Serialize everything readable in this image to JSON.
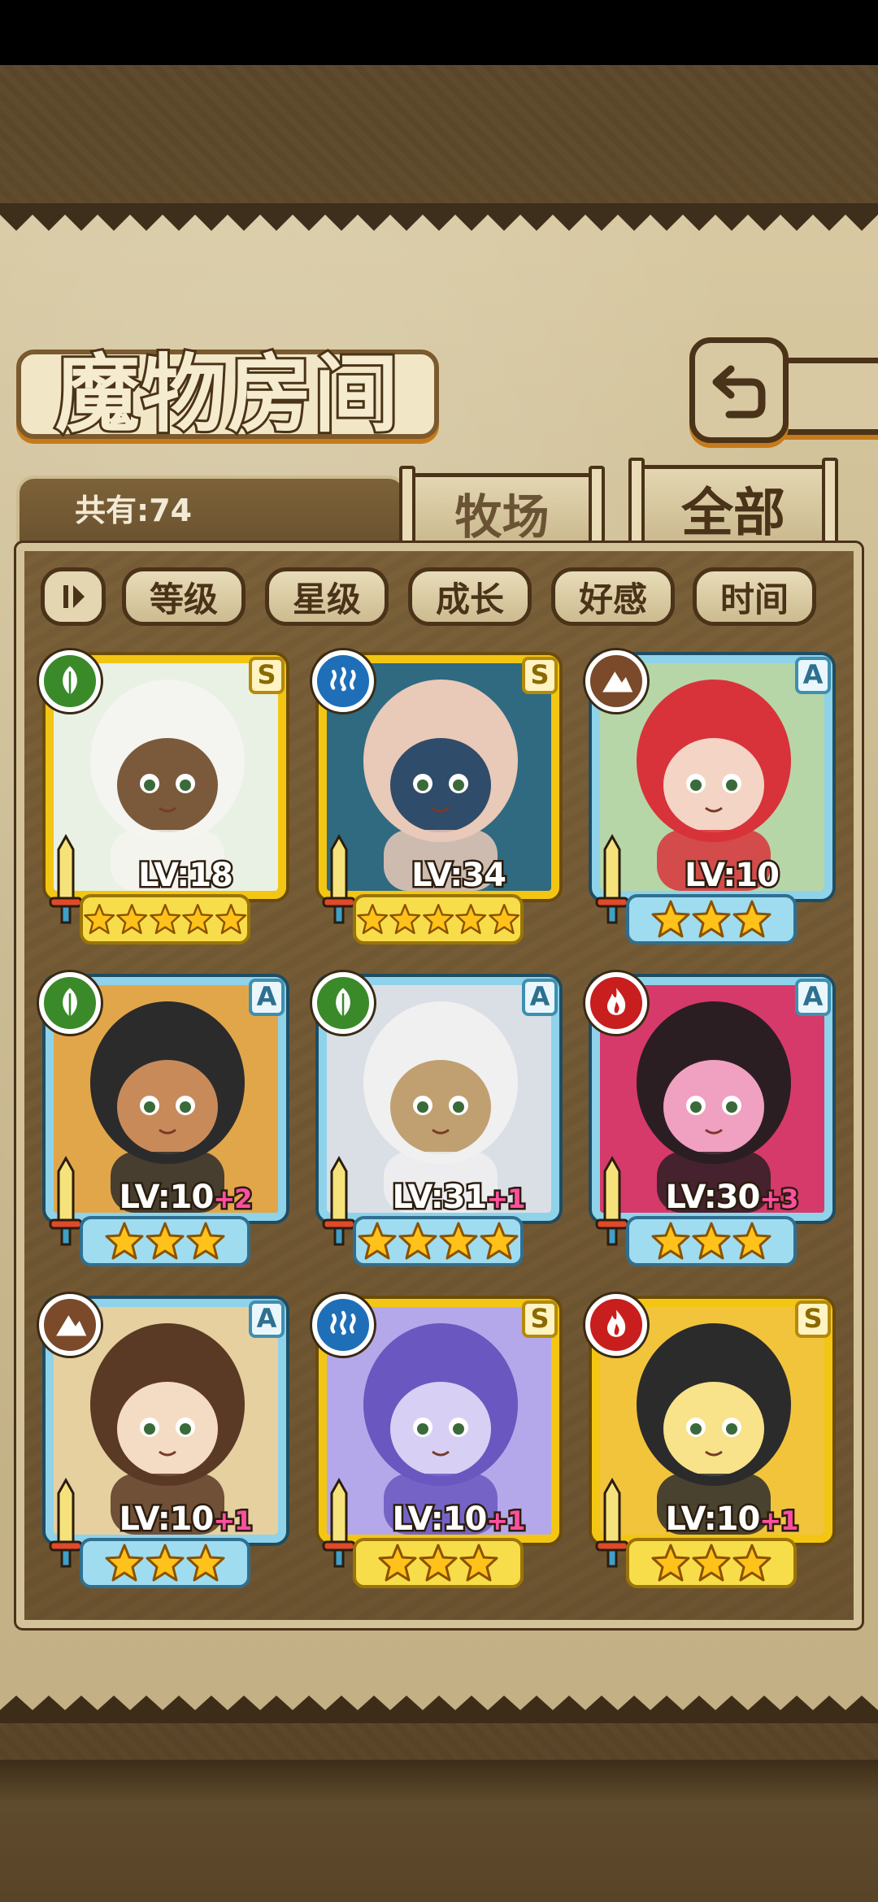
{
  "header": {
    "title": "魔物房间"
  },
  "collection": {
    "count_label": "共有:74"
  },
  "tabs": [
    {
      "label": "牧场",
      "active": false
    },
    {
      "label": "全部",
      "active": true
    }
  ],
  "sort_buttons": [
    "等级",
    "星级",
    "成长",
    "好感",
    "时间"
  ],
  "element_colors": {
    "grass": "#3a8a2a",
    "water": "#1f6fb8",
    "earth": "#7a4a2a",
    "fire": "#c81e1e"
  },
  "monsters": [
    {
      "element": "grass",
      "element_icon": "leaf-icon",
      "rank": "S",
      "level": "LV:18",
      "bonus": "",
      "stars": 5
    },
    {
      "element": "water",
      "element_icon": "wave-icon",
      "rank": "S",
      "level": "LV:34",
      "bonus": "",
      "stars": 5
    },
    {
      "element": "earth",
      "element_icon": "mountain-icon",
      "rank": "A",
      "level": "LV:10",
      "bonus": "",
      "stars": 3
    },
    {
      "element": "grass",
      "element_icon": "leaf-icon",
      "rank": "A",
      "level": "LV:10",
      "bonus": "+2",
      "stars": 3
    },
    {
      "element": "grass",
      "element_icon": "leaf-icon",
      "rank": "A",
      "level": "LV:31",
      "bonus": "+1",
      "stars": 4
    },
    {
      "element": "fire",
      "element_icon": "flame-icon",
      "rank": "A",
      "level": "LV:30",
      "bonus": "+3",
      "stars": 3
    },
    {
      "element": "earth",
      "element_icon": "mountain-icon",
      "rank": "A",
      "level": "LV:10",
      "bonus": "+1",
      "stars": 3
    },
    {
      "element": "water",
      "element_icon": "wave-icon",
      "rank": "S",
      "level": "LV:10",
      "bonus": "+1",
      "stars": 3
    },
    {
      "element": "fire",
      "element_icon": "flame-icon",
      "rank": "S",
      "level": "LV:10",
      "bonus": "+1",
      "stars": 3
    }
  ]
}
